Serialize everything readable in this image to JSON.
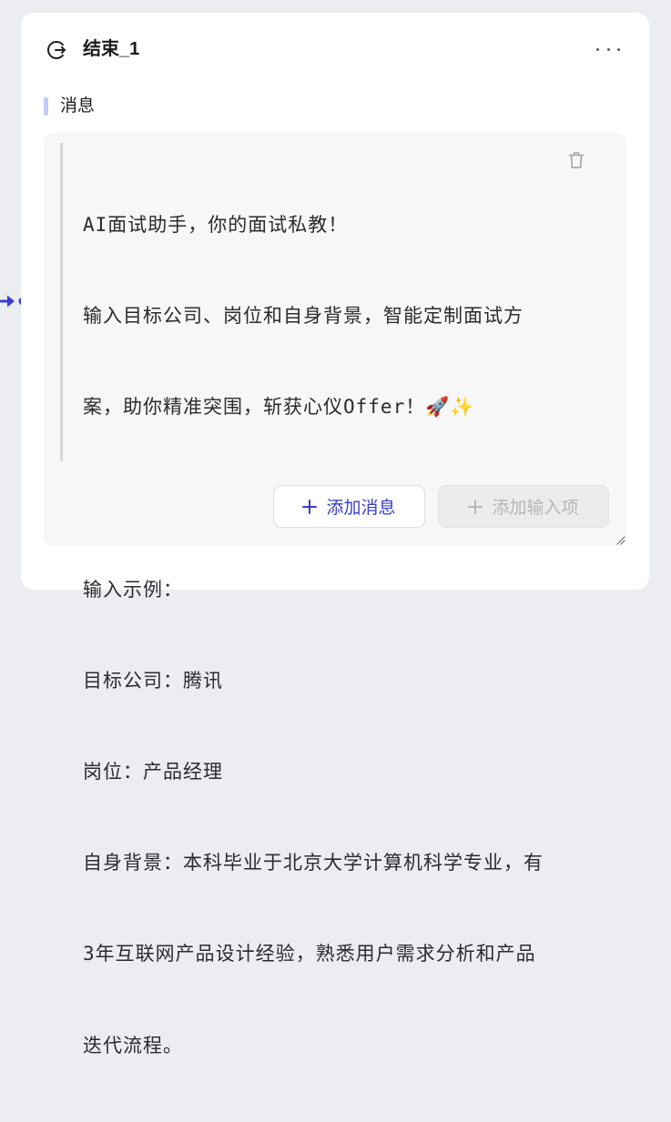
{
  "node": {
    "title": "结束_1",
    "icon": "exit-icon",
    "more_icon": "more-horizontal-icon"
  },
  "section": {
    "label": "消息"
  },
  "message": {
    "lines": [
      "AI面试助手，你的面试私教！",
      "输入目标公司、岗位和自身背景，智能定制面试方",
      "案，助你精准突围，斩获心仪Offer！🚀✨",
      "",
      "输入示例：",
      "目标公司：腾讯",
      "岗位：产品经理",
      "自身背景：本科毕业于北京大学计算机科学专业，有",
      "3年互联网产品设计经验，熟悉用户需求分析和产品",
      "迭代流程。"
    ],
    "delete_icon": "trash-icon"
  },
  "buttons": {
    "add_message": "添加消息",
    "add_input": "添加输入项",
    "add_input_disabled": true,
    "plus_icon": "plus-icon"
  },
  "colors": {
    "background": "#ebedf0",
    "card": "#ffffff",
    "accent": "#3a3dc9",
    "section_bar": "#c7c9f6",
    "message_box": "#f7f7f8",
    "disabled_text": "#b6b6b9"
  }
}
